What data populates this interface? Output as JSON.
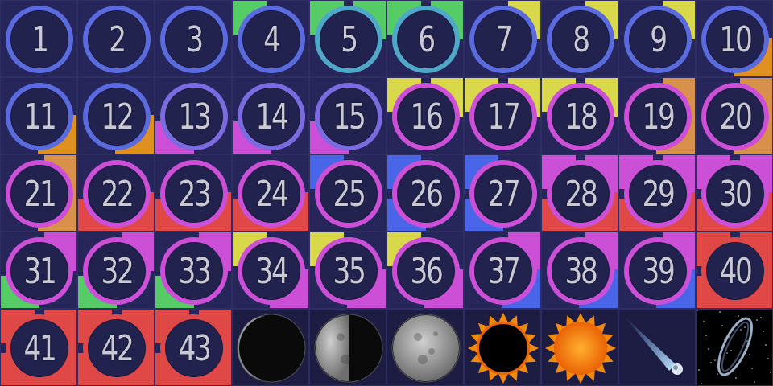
{
  "tiles": [
    {
      "label": "1",
      "ring": "#5a6be0",
      "tl": null,
      "tr": null,
      "bl": null,
      "br": null
    },
    {
      "label": "2",
      "ring": "#5a6be0",
      "tl": null,
      "tr": null,
      "bl": null,
      "br": null
    },
    {
      "label": "3",
      "ring": "#5a6be0",
      "tl": null,
      "tr": null,
      "bl": null,
      "br": null
    },
    {
      "label": "4",
      "ring": "#5a6be0",
      "tl": "#55cc66",
      "tr": null,
      "bl": null,
      "br": null
    },
    {
      "label": "5",
      "ring": "#4fa8c8",
      "tl": "#55cc66",
      "tr": "#55cc66",
      "bl": null,
      "br": null
    },
    {
      "label": "6",
      "ring": "#4fa8c8",
      "tl": "#55cc66",
      "tr": "#55cc66",
      "bl": null,
      "br": null
    },
    {
      "label": "7",
      "ring": "#5a6be0",
      "tl": null,
      "tr": "#d8d84a",
      "bl": null,
      "br": null
    },
    {
      "label": "8",
      "ring": "#5a6be0",
      "tl": null,
      "tr": "#d8d84a",
      "bl": null,
      "br": null
    },
    {
      "label": "9",
      "ring": "#5a6be0",
      "tl": null,
      "tr": "#d8d84a",
      "bl": null,
      "br": null
    },
    {
      "label": "10",
      "ring": "#5a6be0",
      "tl": null,
      "tr": null,
      "bl": null,
      "br": "#e0901e"
    },
    {
      "label": "11",
      "ring": "#5a6be0",
      "tl": null,
      "tr": null,
      "bl": null,
      "br": "#e0901e"
    },
    {
      "label": "12",
      "ring": "#5a6be0",
      "tl": null,
      "tr": null,
      "bl": null,
      "br": "#e0901e"
    },
    {
      "label": "13",
      "ring": "#7a6be0",
      "tl": null,
      "tr": null,
      "bl": "#cc4fd8",
      "br": null
    },
    {
      "label": "14",
      "ring": "#7a6be0",
      "tl": null,
      "tr": null,
      "bl": "#cc4fd8",
      "br": null
    },
    {
      "label": "15",
      "ring": "#7a6be0",
      "tl": null,
      "tr": null,
      "bl": "#cc4fd8",
      "br": null
    },
    {
      "label": "16",
      "ring": "#cc4fd8",
      "tl": "#d8d84a",
      "tr": "#d8d84a",
      "bl": null,
      "br": null
    },
    {
      "label": "17",
      "ring": "#cc4fd8",
      "tl": "#d8d84a",
      "tr": "#d8d84a",
      "bl": null,
      "br": null
    },
    {
      "label": "18",
      "ring": "#cc4fd8",
      "tl": "#d8d84a",
      "tr": "#d8d84a",
      "bl": null,
      "br": null
    },
    {
      "label": "19",
      "ring": "#cc4fd8",
      "tl": null,
      "tr": "#d8904a",
      "bl": null,
      "br": "#d8904a"
    },
    {
      "label": "20",
      "ring": "#cc4fd8",
      "tl": null,
      "tr": "#d8904a",
      "bl": null,
      "br": "#d8904a"
    },
    {
      "label": "21",
      "ring": "#cc4fd8",
      "tl": null,
      "tr": "#d8904a",
      "bl": null,
      "br": "#d8904a"
    },
    {
      "label": "22",
      "ring": "#cc4fd8",
      "tl": null,
      "tr": null,
      "bl": "#e04848",
      "br": "#e04848"
    },
    {
      "label": "23",
      "ring": "#cc4fd8",
      "tl": null,
      "tr": null,
      "bl": "#e04848",
      "br": "#e04848"
    },
    {
      "label": "24",
      "ring": "#cc4fd8",
      "tl": null,
      "tr": null,
      "bl": "#e04848",
      "br": "#e04848"
    },
    {
      "label": "25",
      "ring": "#cc4fd8",
      "tl": "#4a66e8",
      "tr": null,
      "bl": null,
      "br": null
    },
    {
      "label": "26",
      "ring": "#cc4fd8",
      "tl": "#4a66e8",
      "tr": null,
      "bl": "#4a66e8",
      "br": null
    },
    {
      "label": "27",
      "ring": "#cc4fd8",
      "tl": "#4a66e8",
      "tr": null,
      "bl": "#4a66e8",
      "br": null
    },
    {
      "label": "28",
      "ring": "#cc4fd8",
      "tl": "#cc4fd8",
      "tr": "#cc4fd8",
      "bl": "#e04848",
      "br": "#e04848"
    },
    {
      "label": "29",
      "ring": "#cc4fd8",
      "tl": "#cc4fd8",
      "tr": "#cc4fd8",
      "bl": "#e04848",
      "br": "#e04848"
    },
    {
      "label": "30",
      "ring": "#cc4fd8",
      "tl": "#cc4fd8",
      "tr": "#cc4fd8",
      "bl": "#e04848",
      "br": "#e04848"
    },
    {
      "label": "31",
      "ring": "#cc4fd8",
      "tl": null,
      "tr": "#cc4fd8",
      "bl": "#55cc66",
      "br": null
    },
    {
      "label": "32",
      "ring": "#cc4fd8",
      "tl": null,
      "tr": "#cc4fd8",
      "bl": "#55cc66",
      "br": null
    },
    {
      "label": "33",
      "ring": "#cc4fd8",
      "tl": null,
      "tr": "#cc4fd8",
      "bl": "#55cc66",
      "br": null
    },
    {
      "label": "34",
      "ring": "#cc4fd8",
      "tl": "#d8d84a",
      "tr": null,
      "bl": null,
      "br": "#cc4fd8"
    },
    {
      "label": "35",
      "ring": "#cc4fd8",
      "tl": "#d8d84a",
      "tr": null,
      "bl": null,
      "br": "#cc4fd8"
    },
    {
      "label": "36",
      "ring": "#cc4fd8",
      "tl": "#d8d84a",
      "tr": null,
      "bl": null,
      "br": "#cc4fd8"
    },
    {
      "label": "37",
      "ring": "#cc4fd8",
      "tl": null,
      "tr": "#cc4fd8",
      "bl": null,
      "br": "#4a66e8"
    },
    {
      "label": "38",
      "ring": "#cc4fd8",
      "tl": null,
      "tr": "#cc4fd8",
      "bl": null,
      "br": "#4a66e8"
    },
    {
      "label": "39",
      "ring": "#cc4fd8",
      "tl": null,
      "tr": "#cc4fd8",
      "bl": null,
      "br": "#4a66e8"
    },
    {
      "label": "40",
      "ring": "#e04848",
      "tl": "#e04848",
      "tr": "#e04848",
      "bl": "#e04848",
      "br": "#e04848"
    },
    {
      "label": "41",
      "ring": "#e04848",
      "tl": "#e04848",
      "tr": "#e04848",
      "bl": "#e04848",
      "br": "#e04848"
    },
    {
      "label": "42",
      "ring": "#e04848",
      "tl": "#e04848",
      "tr": "#e04848",
      "bl": "#e04848",
      "br": "#e04848"
    },
    {
      "label": "43",
      "ring": "#e04848",
      "tl": "#e04848",
      "tr": "#e04848",
      "bl": "#e04848",
      "br": "#e04848"
    }
  ],
  "pictures": [
    {
      "icon": "crescent-moon-icon"
    },
    {
      "icon": "half-moon-icon"
    },
    {
      "icon": "full-moon-icon"
    },
    {
      "icon": "solar-eclipse-icon"
    },
    {
      "icon": "sun-icon"
    },
    {
      "icon": "comet-icon"
    },
    {
      "icon": "ring-nebula-icon"
    }
  ]
}
